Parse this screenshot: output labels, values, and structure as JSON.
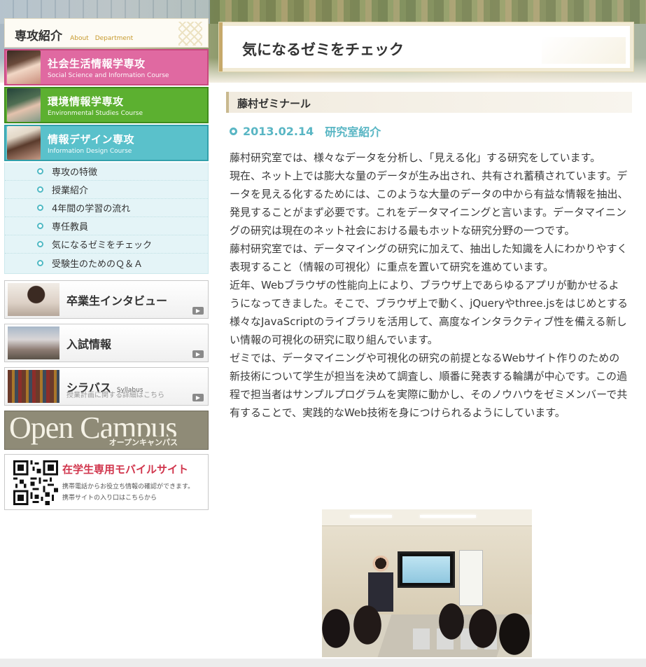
{
  "header": {
    "page_title": "気になるゼミをチェック"
  },
  "sidebar": {
    "heading": {
      "title": "専攻紹介",
      "sub": "About　Department"
    },
    "courses": [
      {
        "title": "社会生活情報学専攻",
        "subtitle": "Social Science and Information Course",
        "color": "#e069a1"
      },
      {
        "title": "環境情報学専攻",
        "subtitle": "Environmental Studies Course",
        "color": "#5cb030"
      },
      {
        "title": "情報デザイン専攻",
        "subtitle": "Information Design Course",
        "color": "#5ac1cb"
      }
    ],
    "submenu": [
      {
        "label": "専攻の特徴"
      },
      {
        "label": "授業紹介"
      },
      {
        "label": "4年間の学習の流れ"
      },
      {
        "label": "専任教員"
      },
      {
        "label": "気になるゼミをチェック"
      },
      {
        "label": "受験生のためのＱ＆Ａ"
      }
    ],
    "banners": {
      "graduate": {
        "label": "卒業生インタビュー"
      },
      "admission": {
        "label": "入試情報"
      },
      "syllabus": {
        "label": "シラバス",
        "sub_en": "Syllabus",
        "desc": "授業計画に関する詳細はこちら"
      },
      "open_campus": {
        "label": "Open Campus",
        "kana": "オープンキャンパス"
      },
      "mobile": {
        "title": "在学生専用モバイルサイト",
        "line1": "携帯電話からお役立ち情報の確認ができます。",
        "line2": "携帯サイトの入り口はこちらから"
      }
    }
  },
  "main": {
    "seminar_title": "藤村ゼミナール",
    "post": {
      "date": "2013.02.14",
      "category": "研究室紹介"
    },
    "body": [
      "藤村研究室では、様々なデータを分析し、「見える化」する研究をしています。",
      "現在、ネット上では膨大な量のデータが生み出され、共有され蓄積されています。データを見える化するためには、このような大量のデータの中から有益な情報を抽出、発見することがまず必要です。これをデータマイニングと言います。データマイニングの研究は現在のネット社会における最もホットな研究分野の一つです。",
      "藤村研究室では、データマイングの研究に加えて、抽出した知識を人にわかりやすく表現すること（情報の可視化）に重点を置いて研究を進めています。",
      "近年、Webブラウザの性能向上により、ブラウザ上であらゆるアプリが動かせるようになってきました。そこで、ブラウザ上で動く、jQueryやthree.jsをはじめとする様々なJavaScriptのライブラリを活用して、高度なインタラクティブ性を備える新しい情報の可視化の研究に取り組んでいます。",
      "ゼミでは、データマイニングや可視化の研究の前提となるWebサイト作りのための新技術について学生が担当を決めて調査し、順番に発表する輪講が中心です。この過程で担当者はサンプルプログラムを実際に動かし、そのノウハウをゼミメンバーで共有することで、実践的なWeb技術を身につけられるようにしています。"
    ]
  },
  "colors": {
    "accent_teal": "#59b6c4",
    "mobile_red": "#d1364d"
  }
}
